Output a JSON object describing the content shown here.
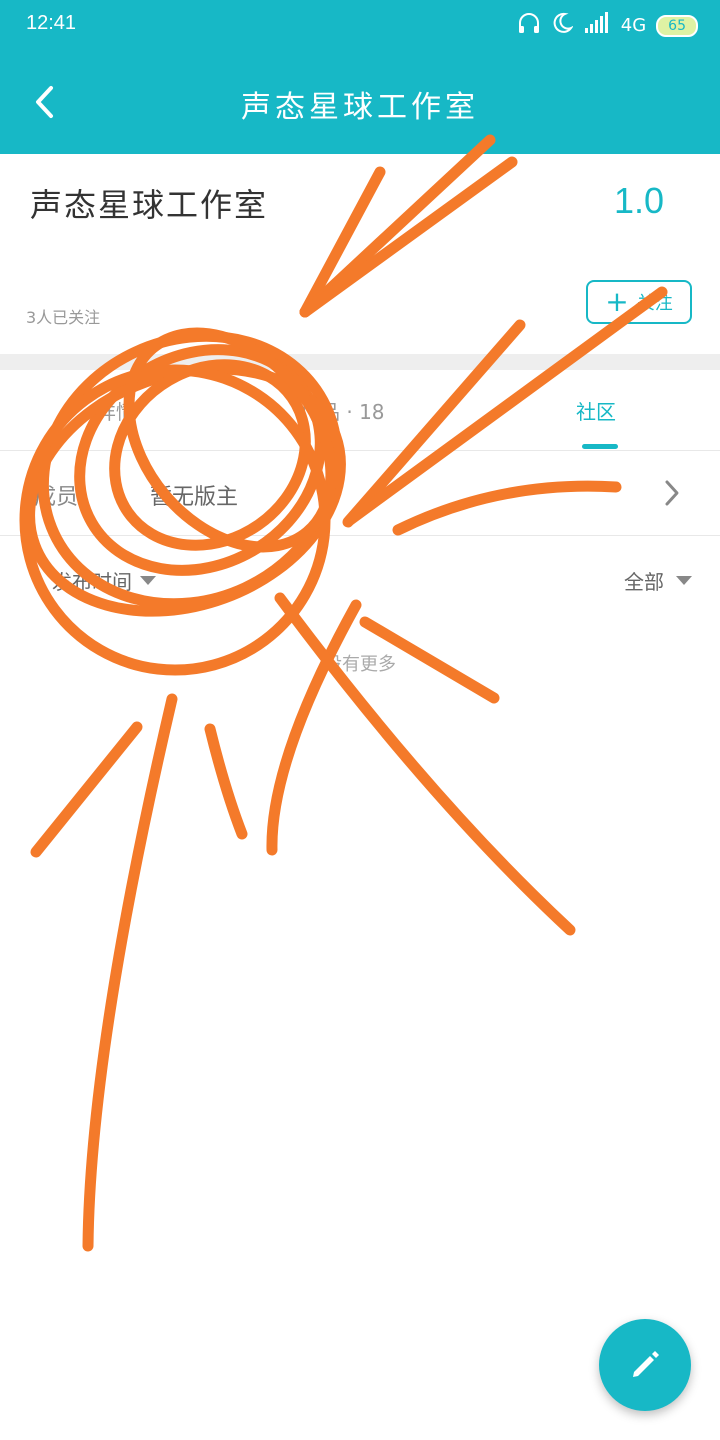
{
  "status": {
    "time": "12:41",
    "network": "4G",
    "battery": "65"
  },
  "appbar": {
    "title": "声态星球工作室"
  },
  "header": {
    "studio_name": "声态星球工作室",
    "version": "1.0",
    "followers": "3人已关注",
    "follow_label": "关注"
  },
  "tabs": [
    {
      "label": "详情"
    },
    {
      "label": "作品 · 18"
    },
    {
      "label": "社区"
    }
  ],
  "member": {
    "label": "成员",
    "value": "暂无版主"
  },
  "filters": {
    "left": "发布时间",
    "right": "全部"
  },
  "empty_text": "没有更多",
  "colors": {
    "accent": "#17b8c6",
    "scribble": "#f47a2a"
  },
  "icons": {
    "back": "chevron-left-icon",
    "follow": "plus-icon",
    "row": "chevron-right-icon",
    "fab": "pencil-icon"
  }
}
